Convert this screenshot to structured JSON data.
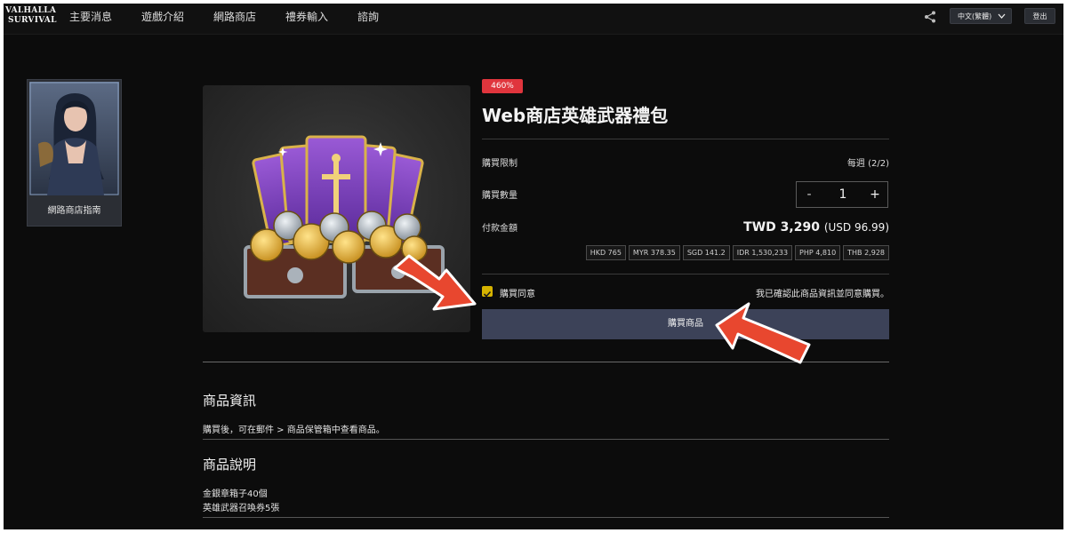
{
  "brand": {
    "logo_line1": "VALHALLA",
    "logo_line2": "SURVIVAL"
  },
  "nav": {
    "items": [
      "主要消息",
      "遊戲介紹",
      "網路商店",
      "禮券輸入",
      "諮詢"
    ]
  },
  "header": {
    "language": "中文(繁體)",
    "logout": "登出",
    "share_icon": "share-icon"
  },
  "sidebar": {
    "guide_label": "網路商店指南"
  },
  "product": {
    "badge": "460%",
    "title": "Web商店英雄武器禮包",
    "purchase_limit_label": "購買限制",
    "purchase_limit_value": "每週 (2/2)",
    "quantity_label": "購買數量",
    "quantity_minus": "-",
    "quantity_value": "1",
    "quantity_plus": "+",
    "payment_label": "付款金額",
    "price_main": "TWD 3,290",
    "price_usd": "(USD 96.99)",
    "currencies": [
      "HKD 765",
      "MYR 378.35",
      "SGD 141.2",
      "IDR 1,530,233",
      "PHP 4,810",
      "THB 2,928"
    ],
    "agree_label": "購買同意",
    "agree_note": "我已確認此商品資訊並同意購買。",
    "buy_button": "購買商品"
  },
  "info": {
    "title": "商品資訊",
    "text": "購買後，可在郵件 > 商品保管箱中查看商品。"
  },
  "description": {
    "title": "商品說明",
    "lines": [
      "金銀章箱子40個",
      "英雄武器召喚券5張"
    ]
  },
  "colors": {
    "accent_button": "#3c4258",
    "badge": "#e0353d",
    "checkbox": "#d6b300",
    "arrow": "#e8472f"
  }
}
